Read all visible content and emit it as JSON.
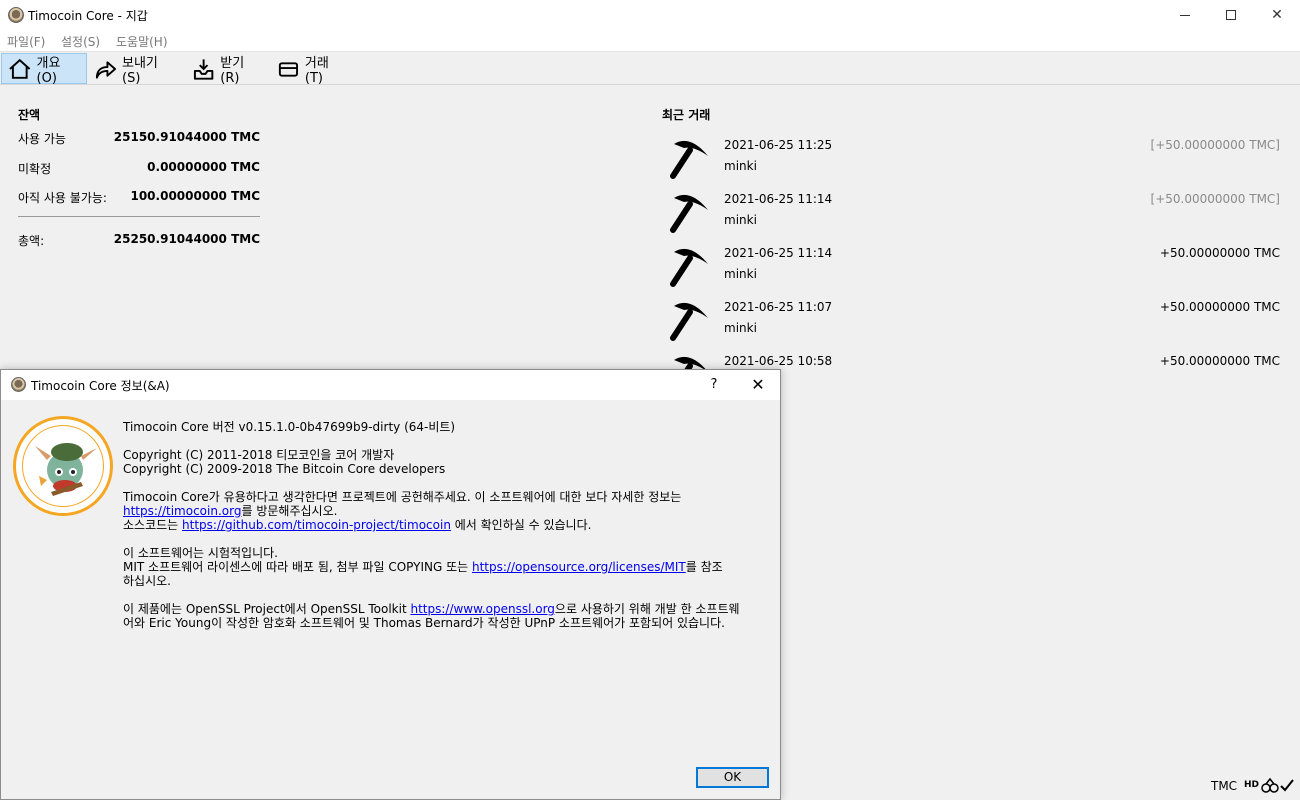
{
  "window": {
    "title": "Timocoin Core - 지갑"
  },
  "menu": {
    "items": [
      "파일(F)",
      "설정(S)",
      "도움말(H)"
    ]
  },
  "toolbar": {
    "overview": "개요(O)",
    "send": "보내기(S)",
    "receive": "받기(R)",
    "transactions": "거래(T)"
  },
  "balances": {
    "heading": "잔액",
    "available_label": "사용 가능",
    "available_value": "25150.91044000 TMC",
    "pending_label": "미확정",
    "pending_value": "0.00000000 TMC",
    "immature_label": "아직 사용 불가능:",
    "immature_value": "100.00000000 TMC",
    "total_label": "총액:",
    "total_value": "25250.91044000 TMC"
  },
  "recent": {
    "heading": "최근 거래",
    "transactions": [
      {
        "date": "2021-06-25 11:25",
        "label": "minki",
        "amount": "[+50.00000000 TMC]",
        "confirmed": false
      },
      {
        "date": "2021-06-25 11:14",
        "label": "minki",
        "amount": "[+50.00000000 TMC]",
        "confirmed": false
      },
      {
        "date": "2021-06-25 11:14",
        "label": "minki",
        "amount": "+50.00000000 TMC",
        "confirmed": true
      },
      {
        "date": "2021-06-25 11:07",
        "label": "minki",
        "amount": "+50.00000000 TMC",
        "confirmed": true
      },
      {
        "date": "2021-06-25 10:58",
        "label": "",
        "amount": "+50.00000000 TMC",
        "confirmed": true
      }
    ]
  },
  "statusbar": {
    "unit": "TMC",
    "hd": "HD"
  },
  "dialog": {
    "title": "Timocoin Core 정보(&A)",
    "help": "?",
    "close": "✕",
    "version": "Timocoin Core 버전 v0.15.1.0-0b47699b9-dirty (64-비트)",
    "copyright1": "Copyright (C) 2011-2018 티모코인을 코어 개발자",
    "copyright2": "Copyright (C) 2009-2018 The Bitcoin Core developers",
    "contrib_line1": "Timocoin Core가 유용하다고 생각한다면 프로젝트에 공헌해주세요. 이 소프트웨어에 대한 보다 자세한 정보는",
    "contrib_link1": "https://timocoin.org",
    "contrib_line2_suffix": "를 방문해주십시오.",
    "source_prefix": "소스코드는 ",
    "source_link": "https://github.com/timocoin-project/timocoin",
    "source_suffix": " 에서 확인하실 수 있습니다.",
    "experimental": "이 소프트웨어는 시험적입니다.",
    "license_prefix": "MIT 소프트웨어 라이센스에 따라 배포 됨, 첨부 파일 COPYING 또는 ",
    "license_link": "https://opensource.org/licenses/MIT",
    "license_suffix": "를 참조",
    "license_line2": "하십시오.",
    "openssl_prefix": "이 제품에는 OpenSSL Project에서 OpenSSL Toolkit ",
    "openssl_link": "https://www.openssl.org",
    "openssl_suffix": "으로 사용하기 위해 개발 한 소프트웨",
    "openssl_line2": "어와 Eric Young이 작성한 암호화 소프트웨어 및 Thomas Bernard가 작성한 UPnP 소프트웨어가 포함되어 있습니다.",
    "ok": "OK"
  }
}
